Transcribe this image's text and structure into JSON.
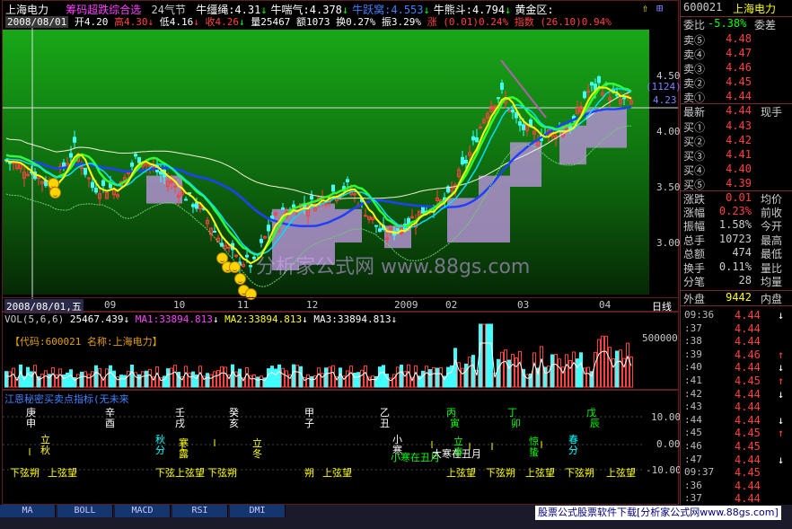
{
  "header": {
    "stock_name": "上海电力",
    "indicator_name": "筹码超跌综合选",
    "solar_term": "24气节",
    "items": [
      {
        "label": "牛缰绳",
        "value": "4.31",
        "color": "#ffffff",
        "arrow": "↓"
      },
      {
        "label": "牛喘气",
        "value": "4.378",
        "color": "#ffffff",
        "arrow": "↓"
      },
      {
        "label": "牛跃窝",
        "value": "4.553",
        "color": "#4080ff",
        "arrow": "↓"
      },
      {
        "label": "牛熊斗",
        "value": "4.794",
        "color": "#ffffff",
        "arrow": "↓"
      },
      {
        "label": "黄金区",
        "value": "",
        "color": "#ffffff",
        "arrow": ""
      }
    ]
  },
  "ohlc": {
    "date": "2008/08/01",
    "open": "开4.20",
    "high": "高4.30",
    "low": "低4.16",
    "close": "收4.26",
    "volume": "量25467",
    "amount": "额1073",
    "turnover": "换0.27%",
    "amplitude": "振3.29%",
    "change": "涨 (0.01)0.24%",
    "index": "指数 (26.10)0.94%"
  },
  "price_axis": [
    "4.50",
    "4.00",
    "3.50",
    "3.00"
  ],
  "price_marker": {
    "label": "(1124)",
    "value": "4.23"
  },
  "date_axis": [
    "2008/08/01,五",
    "09",
    "10",
    "11",
    "12",
    "2009",
    "02",
    "03",
    "04"
  ],
  "date_axis_end": "日线",
  "watermark": "分析家公式网 www.88gs.com",
  "volume_panel": {
    "title": "VOL(5,6,6)",
    "value": "25467.439",
    "ma1": "MA1:33894.813",
    "ma2": "MA2:33894.813",
    "ma3": "MA3:33894.813",
    "code_label": "【代码:600021 名称:上海电力】",
    "axis": "500000"
  },
  "indicator_panel": {
    "title": "江恩秘密买卖点指标(无未来",
    "axis": [
      "10.00",
      "0.00",
      "-10.00"
    ],
    "ganzhi": [
      {
        "text": "庚申",
        "color": "#ffffff"
      },
      {
        "text": "辛酉",
        "color": "#ffffff"
      },
      {
        "text": "壬戌",
        "color": "#ffffff"
      },
      {
        "text": "癸亥",
        "color": "#ffffff"
      },
      {
        "text": "甲子",
        "color": "#ffffff"
      },
      {
        "text": "乙丑",
        "color": "#ffffff"
      },
      {
        "text": "丙寅",
        "color": "#00ff00"
      },
      {
        "text": "丁卯",
        "color": "#00ff00"
      },
      {
        "text": "戊辰",
        "color": "#00ff00"
      }
    ],
    "terms": [
      {
        "text": "立秋",
        "color": "#ffff00"
      },
      {
        "text": "秋分",
        "color": "#00ffff"
      },
      {
        "text": "寒露",
        "color": "#ffff00"
      },
      {
        "text": "立冬",
        "color": "#ffff00"
      },
      {
        "text": "小寒",
        "color": "#ffffff"
      },
      {
        "text": "立春",
        "color": "#00ff00"
      },
      {
        "text": "惊蛰",
        "color": "#00ff00"
      },
      {
        "text": "春分",
        "color": "#00ffff"
      }
    ],
    "moon": [
      "下弦朔",
      "上弦望",
      "下弦上弦望",
      "下弦朔",
      "朔",
      "上弦望",
      "上弦望",
      "下弦朔",
      "上弦望",
      "下弦朔",
      "上弦望"
    ],
    "notes": [
      {
        "text": "小寒在丑月",
        "color": "#00ff00"
      },
      {
        "text": "大寒在丑月",
        "color": "#ffffff"
      }
    ]
  },
  "quote": {
    "code": "600021",
    "name": "上海电力",
    "ratio_label": "委比",
    "ratio_value": "-5.38%",
    "diff_label": "委差",
    "sells": [
      {
        "label": "卖⑤",
        "price": "4.48"
      },
      {
        "label": "卖④",
        "price": "4.47"
      },
      {
        "label": "卖③",
        "price": "4.46"
      },
      {
        "label": "卖②",
        "price": "4.45"
      },
      {
        "label": "卖①",
        "price": "4.44"
      }
    ],
    "last_label": "最新",
    "last_value": "4.44",
    "last_right": "现手",
    "buys": [
      {
        "label": "买①",
        "price": "4.43"
      },
      {
        "label": "买②",
        "price": "4.42"
      },
      {
        "label": "买③",
        "price": "4.41"
      },
      {
        "label": "买④",
        "price": "4.40"
      },
      {
        "label": "买⑤",
        "price": "4.39"
      }
    ],
    "stats": [
      {
        "label": "涨跌",
        "value": "0.01",
        "right": "均价",
        "color": "#ff4040"
      },
      {
        "label": "涨幅",
        "value": "0.23%",
        "right": "前收",
        "color": "#ff4040"
      },
      {
        "label": "振幅",
        "value": "1.58%",
        "right": "今开",
        "color": "#cccccc"
      },
      {
        "label": "总手",
        "value": "10723",
        "right": "最高",
        "color": "#cccccc"
      },
      {
        "label": "总额",
        "value": "474",
        "right": "最低",
        "color": "#cccccc"
      },
      {
        "label": "换手",
        "value": "0.11%",
        "right": "量比",
        "color": "#cccccc"
      },
      {
        "label": "分笔",
        "value": "28",
        "right": "均量",
        "color": "#cccccc"
      }
    ],
    "outer_label": "外盘",
    "outer_value": "9442",
    "inner_label": "内盘",
    "ticks": [
      {
        "time": "09:36",
        "price": "4.44",
        "arrow": "↓",
        "acolor": "#ffffff"
      },
      {
        "time": ":37",
        "price": "4.44",
        "arrow": "",
        "acolor": "#ffffff"
      },
      {
        "time": ":38",
        "price": "4.44",
        "arrow": "",
        "acolor": "#ffffff"
      },
      {
        "time": ":39",
        "price": "4.46",
        "arrow": "↑",
        "acolor": "#ff4040"
      },
      {
        "time": ":40",
        "price": "4.44",
        "arrow": "↓",
        "acolor": "#ffffff"
      },
      {
        "time": ":41",
        "price": "4.45",
        "arrow": "↑",
        "acolor": "#ff4040"
      },
      {
        "time": ":42",
        "price": "4.44",
        "arrow": "↓",
        "acolor": "#ffffff"
      },
      {
        "time": ":43",
        "price": "4.44",
        "arrow": "",
        "acolor": "#ffffff"
      },
      {
        "time": ":44",
        "price": "4.44",
        "arrow": "↓",
        "acolor": "#ffffff"
      },
      {
        "time": ":45",
        "price": "4.45",
        "arrow": "↑",
        "acolor": "#ff4040"
      },
      {
        "time": ":46",
        "price": "4.45",
        "arrow": "",
        "acolor": "#ffffff"
      },
      {
        "time": ":47",
        "price": "4.44",
        "arrow": "↓",
        "acolor": "#ffffff"
      },
      {
        "time": "09:37",
        "price": "4.45",
        "arrow": "",
        "acolor": "#ffffff"
      },
      {
        "time": ":36",
        "price": "4.44",
        "arrow": "",
        "acolor": "#ffffff"
      },
      {
        "time": ":37",
        "price": "4.44",
        "arrow": "",
        "acolor": "#ffffff"
      }
    ]
  },
  "tabs": [
    "MA",
    "BOLL",
    "MACD",
    "RSI",
    "DMI"
  ],
  "footer_ad": "股票公式股票软件下载[分析家公式网www.88gs.com]",
  "colors": {
    "up": "#ff4040",
    "down": "#00ff00",
    "bg": "#000000",
    "border": "#7a2a2a",
    "band_green": "#22a022"
  }
}
